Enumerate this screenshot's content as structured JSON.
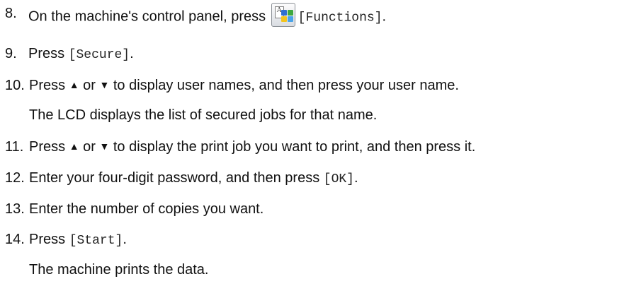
{
  "steps": [
    {
      "number": "8.",
      "before": "On the machine's control panel, press ",
      "button": "[Functions]",
      "after": ".",
      "icon": "functions-icon"
    },
    {
      "number": "9.",
      "before": "Press ",
      "button": "[Secure]",
      "after": "."
    },
    {
      "number": "10.",
      "text_a": "Press ",
      "up_arrow": "▲",
      "text_b": " or ",
      "down_arrow": "▼",
      "text_c": " to display user names, and then press your user name.",
      "note": "The LCD displays the list of secured jobs for that name."
    },
    {
      "number": "11.",
      "text_a": "Press ",
      "up_arrow": "▲",
      "text_b": " or ",
      "down_arrow": "▼",
      "text_c": " to display the print job you want to print, and then press it."
    },
    {
      "number": "12.",
      "before": "Enter your four-digit password, and then press ",
      "button": "[OK]",
      "after": "."
    },
    {
      "number": "13.",
      "text": "Enter the number of copies you want."
    },
    {
      "number": "14.",
      "before": "Press ",
      "button": "[Start]",
      "after": ".",
      "note": "The machine prints the data."
    }
  ],
  "colors": {
    "icon_blue": "#2f6fd1",
    "icon_green": "#3ea83e",
    "icon_yellow": "#f2c41f",
    "icon_light_blue": "#4aa3e8"
  }
}
